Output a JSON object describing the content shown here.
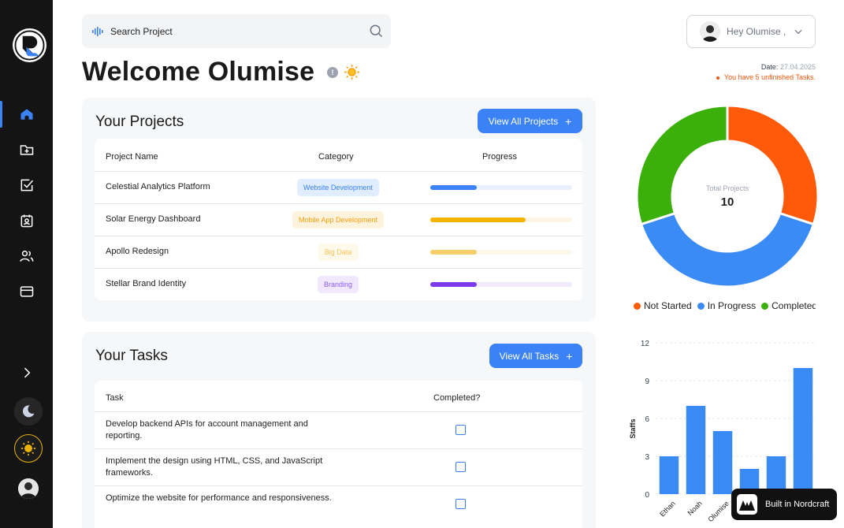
{
  "search": {
    "placeholder": "Search Project"
  },
  "user": {
    "greeting": "Hey Olumise ,"
  },
  "welcome": {
    "title": "Welcome Olumise",
    "info": "!"
  },
  "status": {
    "date_label": "Date:",
    "date_value": "27.04.2025",
    "warning": "You have 5 unfinished Tasks."
  },
  "projects": {
    "title": "Your Projects",
    "button": "View All Projects",
    "button_icon": "+",
    "headers": {
      "name": "Project Name",
      "category": "Category",
      "progress": "Progress"
    },
    "rows": [
      {
        "name": "Celestial Analytics Platform",
        "category": "Website Development",
        "progress": 0.33,
        "tag_bg": "#e0ecff",
        "tag_fg": "#3b82f6",
        "bar_color": "#3b82f6",
        "track_color": "#e8f0fd"
      },
      {
        "name": "Solar Energy Dashboard",
        "category": "Mobile App Development",
        "progress": 0.67,
        "tag_bg": "#fef3dc",
        "tag_fg": "#f59e0b",
        "bar_color": "#f5b400",
        "track_color": "#fdf6e6"
      },
      {
        "name": "Apollo Redesign",
        "category": "Big Data",
        "progress": 0.33,
        "tag_bg": "#fff9ec",
        "tag_fg": "#f6c453",
        "bar_color": "#f7cf6a",
        "track_color": "#fdf8ec"
      },
      {
        "name": "Stellar Brand Identity",
        "category": "Branding",
        "progress": 0.33,
        "tag_bg": "#f1e8fd",
        "tag_fg": "#8b5cf6",
        "bar_color": "#7c3aed",
        "track_color": "#f1eafd"
      }
    ]
  },
  "tasks": {
    "title": "Your Tasks",
    "button": "View All Tasks",
    "button_icon": "+",
    "headers": {
      "task": "Task",
      "completed": "Completed?"
    },
    "rows": [
      {
        "text": "Develop backend APIs for account management and reporting.",
        "completed": false
      },
      {
        "text": "Implement the design using HTML, CSS, and JavaScript frameworks.",
        "completed": false
      },
      {
        "text": "Optimize the website for performance and responsiveness.",
        "completed": false
      }
    ]
  },
  "chart_data": [
    {
      "type": "pie",
      "title": "",
      "center_label": "Total Projects",
      "total": "10",
      "categories": [
        "Not Started",
        "In Progress",
        "Completed"
      ],
      "values": [
        3,
        4,
        3
      ],
      "colors": [
        "#ff5a0a",
        "#3b8bf6",
        "#3bb00a"
      ],
      "legend": "bottom"
    },
    {
      "type": "bar",
      "title": "",
      "xlabel": "",
      "ylabel": "Staffs",
      "categories": [
        "Ethan",
        "Noah",
        "Olumise",
        "",
        "",
        ""
      ],
      "values": [
        3,
        7,
        5,
        2,
        3,
        10
      ],
      "yticks": [
        "12",
        "9",
        "6",
        "3",
        "0"
      ],
      "ylim": [
        0,
        12
      ],
      "grid": true,
      "color": "#3b8bf6"
    }
  ],
  "badge": {
    "text": "Built in Nordcraft"
  },
  "icons": {
    "logo": "logo-icon",
    "nav": [
      "home-icon",
      "folder-icon",
      "checkbox-icon",
      "calendar-user-icon",
      "users-icon",
      "card-icon"
    ]
  }
}
